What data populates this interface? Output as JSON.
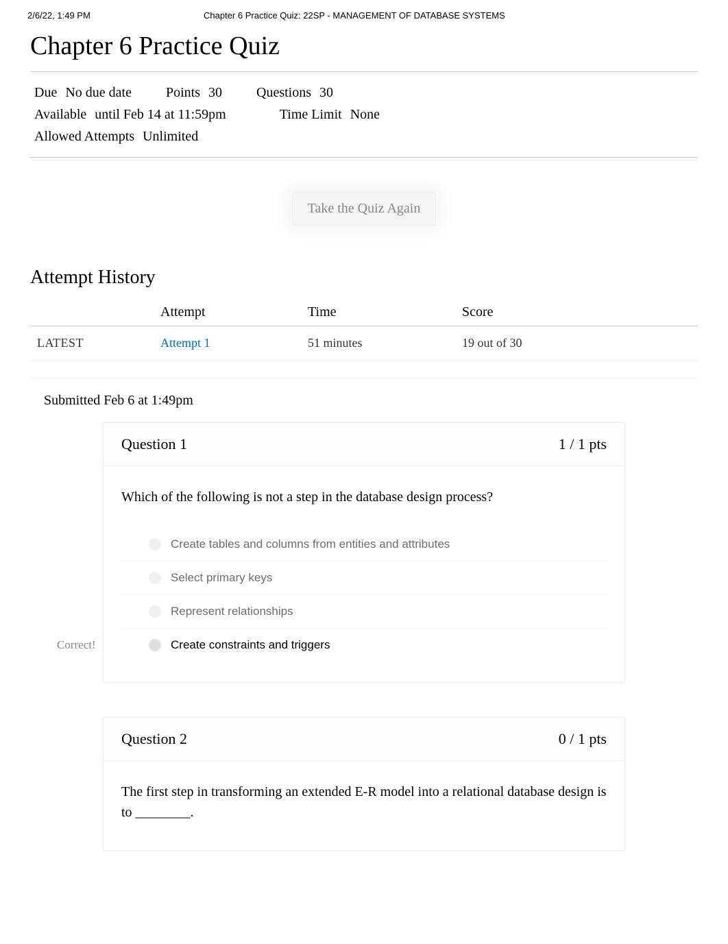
{
  "header": {
    "timestamp": "2/6/22, 1:49 PM",
    "doc_title": "Chapter 6 Practice Quiz: 22SP - MANAGEMENT OF DATABASE SYSTEMS"
  },
  "quiz": {
    "title": "Chapter 6 Practice Quiz",
    "meta": {
      "due_label": "Due",
      "due_value": "No due date",
      "points_label": "Points",
      "points_value": "30",
      "questions_label": "Questions",
      "questions_value": "30",
      "available_label": "Available",
      "available_value": "until Feb 14 at 11:59pm",
      "time_limit_label": "Time Limit",
      "time_limit_value": "None",
      "allowed_attempts_label": "Allowed Attempts",
      "allowed_attempts_value": "Unlimited"
    },
    "take_again_button": "Take the Quiz Again"
  },
  "attempt_history": {
    "title": "Attempt History",
    "columns": {
      "blank": "",
      "attempt": "Attempt",
      "time": "Time",
      "score": "Score"
    },
    "rows": [
      {
        "label": "LATEST",
        "attempt": "Attempt 1",
        "time": "51 minutes",
        "score": "19 out of 30"
      }
    ]
  },
  "submitted_text": "Submitted Feb 6 at 1:49pm",
  "questions": [
    {
      "number": "Question 1",
      "points": "1 / 1 pts",
      "text": "Which of the following is not a step in the database design process?",
      "side_label": "Correct!",
      "answers": [
        {
          "text": "Create tables and columns from entities and attributes",
          "selected": false
        },
        {
          "text": "Select primary keys",
          "selected": false
        },
        {
          "text": "Represent relationships",
          "selected": false
        },
        {
          "text": "Create constraints and triggers",
          "selected": true
        }
      ]
    },
    {
      "number": "Question 2",
      "points": "0 / 1 pts",
      "text": "The first step in transforming an extended E-R model into a relational database design is to ________.",
      "side_label": "",
      "answers": []
    }
  ]
}
